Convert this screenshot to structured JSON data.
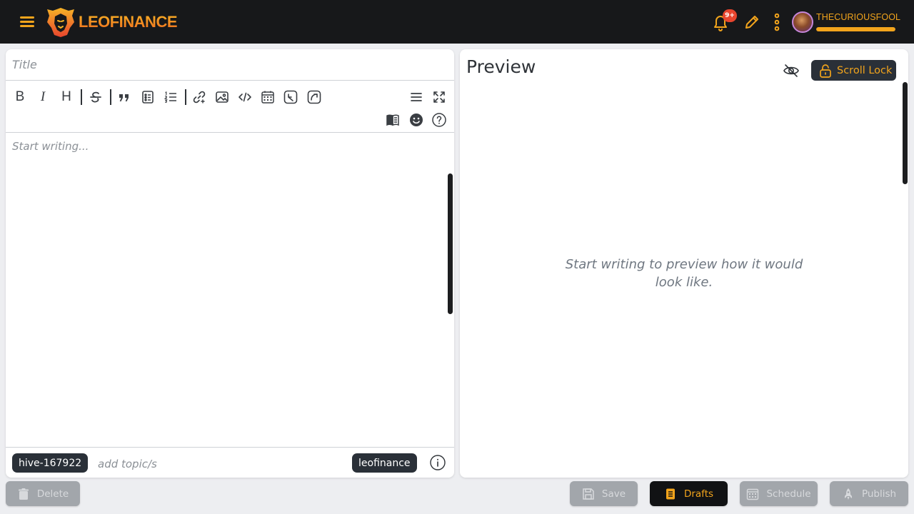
{
  "header": {
    "brand": "LEOFINANCE",
    "notifications_badge": "9+",
    "username": "THECURIOUSFOOL",
    "user_progress_fraction": 1.0,
    "accent_color": "#f2a41c"
  },
  "editor": {
    "title_placeholder": "Title",
    "body_placeholder": "Start writing...",
    "toolbar": [
      "bold",
      "italic",
      "heading",
      "strikethrough",
      "quote",
      "unordered-list",
      "ordered-list",
      "link",
      "image",
      "code",
      "table",
      "undo",
      "redo",
      "align",
      "fullscreen",
      "templates",
      "emoji",
      "help"
    ],
    "toolbar_labels": {
      "bold": "B",
      "italic": "I",
      "heading": "H"
    },
    "tags": {
      "community": "hive-167922",
      "topic_placeholder": "add topic/s",
      "default_tag": "leofinance"
    }
  },
  "preview": {
    "title": "Preview",
    "scroll_lock_label": "Scroll Lock",
    "empty_message": "Start writing to preview how it would look like."
  },
  "actions": {
    "delete": "Delete",
    "save": "Save",
    "drafts": "Drafts",
    "schedule": "Schedule",
    "publish": "Publish"
  }
}
